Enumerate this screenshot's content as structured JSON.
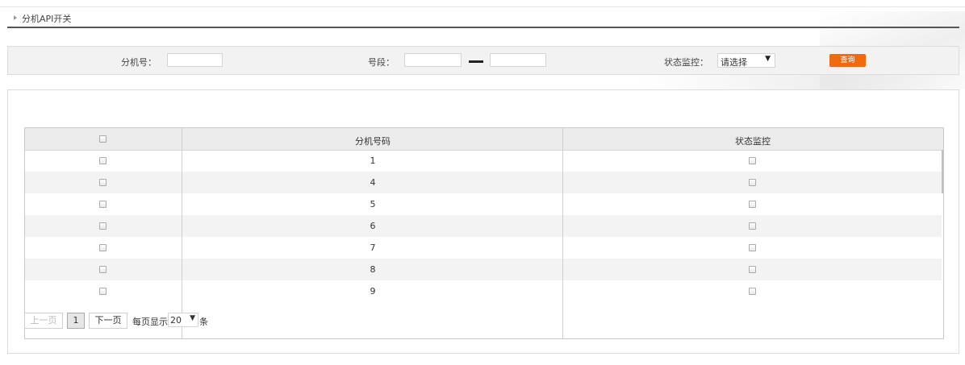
{
  "breadcrumb": {
    "text": "分机API开关"
  },
  "search": {
    "ext_label": "分机号：",
    "ext_value": "",
    "range_label": "号段：",
    "range_from": "",
    "range_to": "",
    "status_label": "状态监控：",
    "status_selected": "请选择",
    "query_button": "查询"
  },
  "table": {
    "columns": [
      "分机号码",
      "状态监控"
    ],
    "rows": [
      {
        "number": "1"
      },
      {
        "number": "4"
      },
      {
        "number": "5"
      },
      {
        "number": "6"
      },
      {
        "number": "7"
      },
      {
        "number": "8"
      },
      {
        "number": "9"
      }
    ]
  },
  "pager": {
    "prev": "上一页",
    "current_page": "1",
    "next": "下一页",
    "per_page_label": "每页显示",
    "per_page_value": "20",
    "unit": "条"
  },
  "colors": {
    "accent": "#f26a10",
    "header_bg": "#ebebeb",
    "alt_row_bg": "#f3f3f3"
  }
}
